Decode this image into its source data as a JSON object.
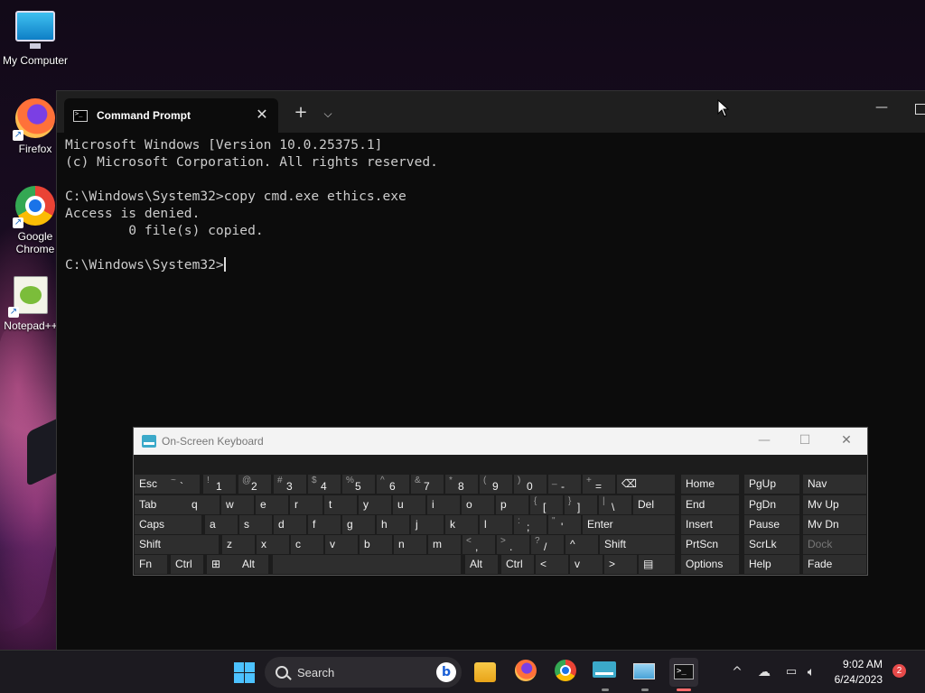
{
  "desktop": {
    "icons": [
      {
        "label": "My Computer",
        "icon": "monitor-icon"
      },
      {
        "label": "Firefox",
        "icon": "firefox-icon"
      },
      {
        "label": "Google Chrome",
        "icon": "chrome-icon"
      },
      {
        "label": "Notepad++",
        "icon": "notepad-plus-plus-icon"
      }
    ]
  },
  "terminal": {
    "tab_title": "Command Prompt",
    "lines": [
      "Microsoft Windows [Version 10.0.25375.1]",
      "(c) Microsoft Corporation. All rights reserved.",
      "",
      "C:\\Windows\\System32>copy cmd.exe ethics.exe",
      "Access is denied.",
      "        0 file(s) copied.",
      "",
      "C:\\Windows\\System32>"
    ]
  },
  "osk": {
    "title": "On-Screen Keyboard",
    "row1": [
      "Esc",
      "~ `",
      "! 1",
      "@ 2",
      "# 3",
      "$ 4",
      "% 5",
      "^ 6",
      "& 7",
      "* 8",
      "( 9",
      ") 0",
      "_ -",
      "+ =",
      "⌫",
      "Home",
      "PgUp",
      "Nav"
    ],
    "row2": [
      "Tab",
      "q",
      "w",
      "e",
      "r",
      "t",
      "y",
      "u",
      "i",
      "o",
      "p",
      "{ [",
      "} ]",
      "| \\",
      "Del",
      "End",
      "PgDn",
      "Mv Up"
    ],
    "row3": [
      "Caps",
      "a",
      "s",
      "d",
      "f",
      "g",
      "h",
      "j",
      "k",
      "l",
      ": ;",
      "\" '",
      "Enter",
      "Insert",
      "Pause",
      "Mv Dn"
    ],
    "row4": [
      "Shift",
      "z",
      "x",
      "c",
      "v",
      "b",
      "n",
      "m",
      "< ,",
      "> .",
      "? /",
      "^",
      "Shift",
      "PrtScn",
      "ScrLk",
      "Dock"
    ],
    "row5": [
      "Fn",
      "Ctrl",
      "⊞",
      "Alt",
      "",
      "Alt",
      "Ctrl",
      "<",
      "v",
      ">",
      "▤",
      "Options",
      "Help",
      "Fade"
    ]
  },
  "taskbar": {
    "search_label": "Search",
    "time": "9:02 AM",
    "date": "6/24/2023",
    "notification_count": "2"
  }
}
